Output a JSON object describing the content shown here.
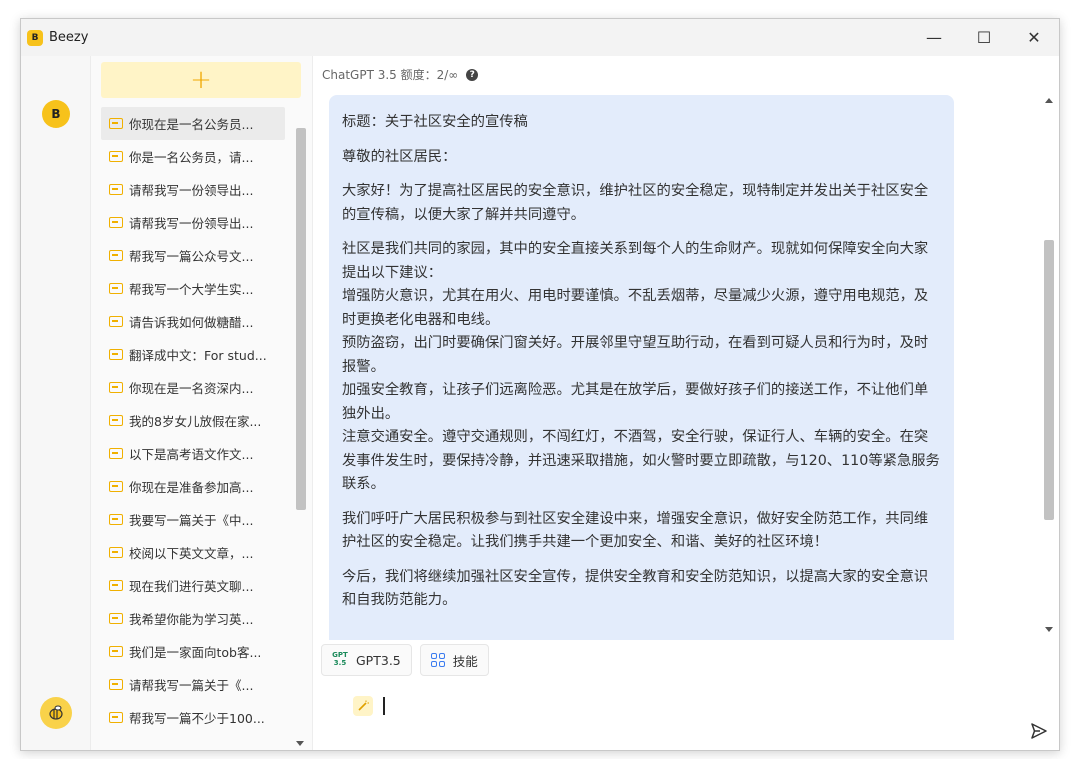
{
  "window": {
    "title": "Beezy",
    "logo_text": "B"
  },
  "window_controls": {
    "minimize": "—",
    "maximize": "☐",
    "close": "✕"
  },
  "rail": {
    "logo_text": "B"
  },
  "sidebar": {
    "new_chat_label": "+",
    "items": [
      {
        "label": "你现在是一名公务员..."
      },
      {
        "label": "你是一名公务员，请..."
      },
      {
        "label": "请帮我写一份领导出..."
      },
      {
        "label": "请帮我写一份领导出..."
      },
      {
        "label": "帮我写一篇公众号文..."
      },
      {
        "label": "帮我写一个大学生实..."
      },
      {
        "label": "请告诉我如何做糖醋..."
      },
      {
        "label": "翻译成中文：For stud..."
      },
      {
        "label": "你现在是一名资深内..."
      },
      {
        "label": "我的8岁女儿放假在家..."
      },
      {
        "label": "以下是高考语文作文..."
      },
      {
        "label": "你现在是准备参加高..."
      },
      {
        "label": "我要写一篇关于《中..."
      },
      {
        "label": "校阅以下英文文章，..."
      },
      {
        "label": "现在我们进行英文聊..."
      },
      {
        "label": "我希望你能为学习英..."
      },
      {
        "label": "我们是一家面向tob客..."
      },
      {
        "label": "请帮我写一篇关于《..."
      },
      {
        "label": "帮我写一篇不少于100..."
      }
    ]
  },
  "header": {
    "quota_text": "ChatGPT 3.5 额度：2/∞",
    "help_icon": "?"
  },
  "message": {
    "paragraphs": [
      "标题：关于社区安全的宣传稿",
      "尊敬的社区居民：",
      "大家好！为了提高社区居民的安全意识，维护社区的安全稳定，现特制定并发出关于社区安全的宣传稿，以便大家了解并共同遵守。",
      "社区是我们共同的家园，其中的安全直接关系到每个人的生命财产。现就如何保障安全向大家提出以下建议：",
      "我们呼吁广大居民积极参与到社区安全建设中来，增强安全意识，做好安全防范工作，共同维护社区的安全稳定。让我们携手共建一个更加安全、和谐、美好的社区环境！",
      "今后，我们将继续加强社区安全宣传，提供安全教育和安全防范知识，以提高大家的安全意识和自我防范能力。"
    ],
    "suggestions": [
      "增强防火意识，尤其在用火、用电时要谨慎。不乱丢烟蒂，尽量减少火源，遵守用电规范，及时更换老化电器和电线。",
      "预防盗窃，出门时要确保门窗关好。开展邻里守望互助行动，在看到可疑人员和行为时，及时报警。",
      "加强安全教育，让孩子们远离险恶。尤其是在放学后，要做好孩子们的接送工作，不让他们单独外出。",
      "注意交通安全。遵守交通规则，不闯红灯，不酒驾，安全行驶，保证行人、车辆的安全。在突发事件发生时，要保持冷静，并迅速采取措施，如火警时要立即疏散，与120、110等紧急服务联系。"
    ]
  },
  "toolbar": {
    "model_icon_text": "GPT 3.5",
    "model_label": "GPT3.5",
    "skills_label": "技能"
  },
  "input": {
    "value": ""
  },
  "colors": {
    "accent": "#f7c21b",
    "bubble": "#e3ecfb",
    "link": "#3b7cf0"
  }
}
